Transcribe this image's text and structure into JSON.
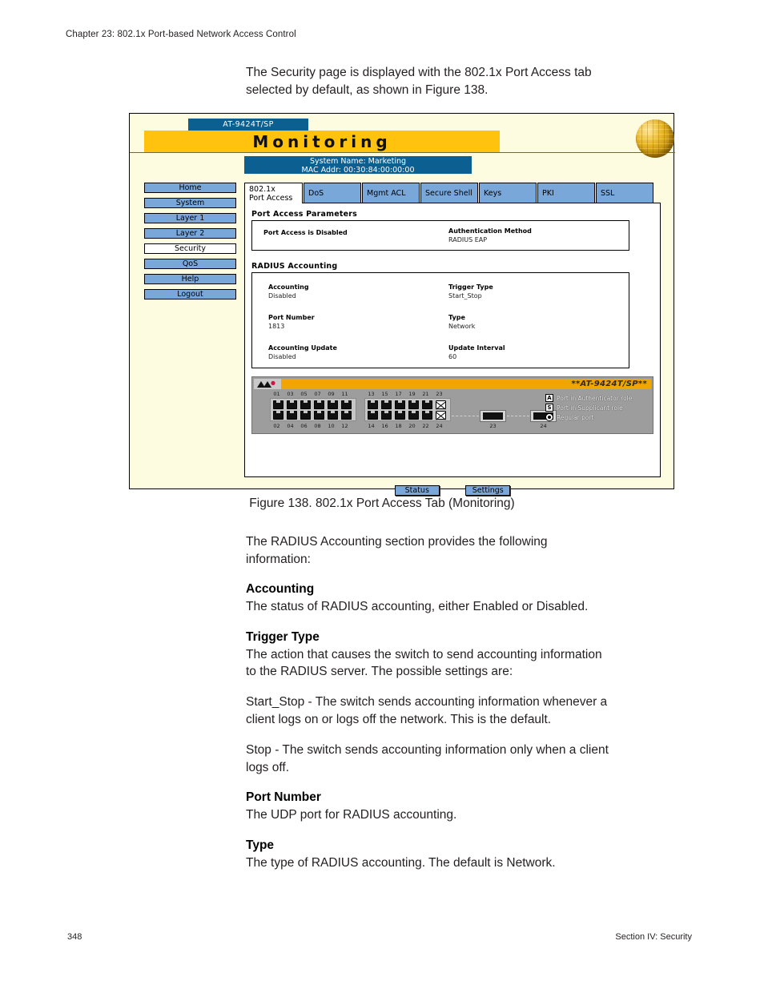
{
  "running_head": "Chapter 23: 802.1x Port-based Network Access Control",
  "intro": {
    "line1": "The Security page is displayed with the 802.1x Port Access tab",
    "line2": "selected by default, as shown in Figure 138."
  },
  "figure": {
    "model_tag": "AT-9424T/SP",
    "banner_title": "Monitoring",
    "system_name": "System Name: Marketing",
    "mac_addr": "MAC Addr: 00:30:84:00:00:00",
    "logo": "globe-icon",
    "nav": {
      "items": [
        {
          "label": "Home",
          "active": false
        },
        {
          "label": "System",
          "active": false
        },
        {
          "label": "Layer 1",
          "active": false
        },
        {
          "label": "Layer 2",
          "active": false
        },
        {
          "label": "Security",
          "active": true
        },
        {
          "label": "QoS",
          "active": false
        },
        {
          "label": "Help",
          "active": false
        },
        {
          "label": "Logout",
          "active": false
        }
      ]
    },
    "tabs": [
      {
        "label_line1": "802.1x",
        "label_line2": "Port Access",
        "active": true
      },
      {
        "label": "DoS",
        "active": false
      },
      {
        "label": "Mgmt ACL",
        "active": false
      },
      {
        "label": "Secure Shell",
        "active": false
      },
      {
        "label": "Keys",
        "active": false
      },
      {
        "label": "PKI",
        "active": false
      },
      {
        "label": "SSL",
        "active": false
      }
    ],
    "port_access_parameters": {
      "title": "Port Access Parameters",
      "status_text": "Port Access is Disabled",
      "auth_method_label": "Authentication Method",
      "auth_method_value": "RADIUS EAP"
    },
    "radius_accounting": {
      "title": "RADIUS Accounting",
      "fields": [
        {
          "label": "Accounting",
          "value": "Disabled"
        },
        {
          "label": "Trigger Type",
          "value": "Start_Stop"
        },
        {
          "label": "Port Number",
          "value": "1813"
        },
        {
          "label": "Type",
          "value": "Network"
        },
        {
          "label": "Accounting Update",
          "value": "Disabled"
        },
        {
          "label": "Update Interval",
          "value": "60"
        }
      ]
    },
    "switch_graphic": {
      "model": "**AT-9424T/SP**",
      "top_row_numbers": [
        "01",
        "03",
        "05",
        "07",
        "09",
        "11",
        "13",
        "15",
        "17",
        "19",
        "21",
        "23"
      ],
      "bottom_row_numbers": [
        "02",
        "04",
        "06",
        "08",
        "10",
        "12",
        "14",
        "16",
        "18",
        "20",
        "22",
        "24"
      ],
      "crossed_ports": [
        "23",
        "24"
      ],
      "gbic_ports": [
        "23",
        "24"
      ],
      "legend": [
        {
          "key": "A",
          "text": "Port in Authenticator role"
        },
        {
          "key": "S",
          "text": "Port in Supplicant role"
        },
        {
          "key": "radio",
          "text": "Regular port"
        }
      ]
    },
    "buttons": [
      {
        "label": "Status"
      },
      {
        "label": "Settings"
      }
    ]
  },
  "caption": "Figure 138.  802.1x Port Access Tab (Monitoring)",
  "body": {
    "radius_intro_l1": "The RADIUS Accounting section provides the following",
    "radius_intro_l2": "information:",
    "accounting_head": "Accounting",
    "accounting_body": "The status of RADIUS accounting, either Enabled or Disabled.",
    "trigger_head": "Trigger Type",
    "trigger_body_l1": "The action that causes the switch to send accounting information",
    "trigger_body_l2": "to the RADIUS server. The possible settings are:",
    "start_stop_l1": "Start_Stop - The switch sends accounting information whenever a",
    "start_stop_l2": "client logs on or logs off the network. This is the default.",
    "stop_l1": "Stop - The switch sends accounting information only when a client",
    "stop_l2": "logs off.",
    "port_number_head": "Port Number",
    "port_number_body": "The UDP port for RADIUS accounting.",
    "type_head": "Type",
    "type_body": "The type of RADIUS accounting. The default is Network."
  },
  "footer": {
    "page_number": "348",
    "section": "Section IV: Security"
  }
}
